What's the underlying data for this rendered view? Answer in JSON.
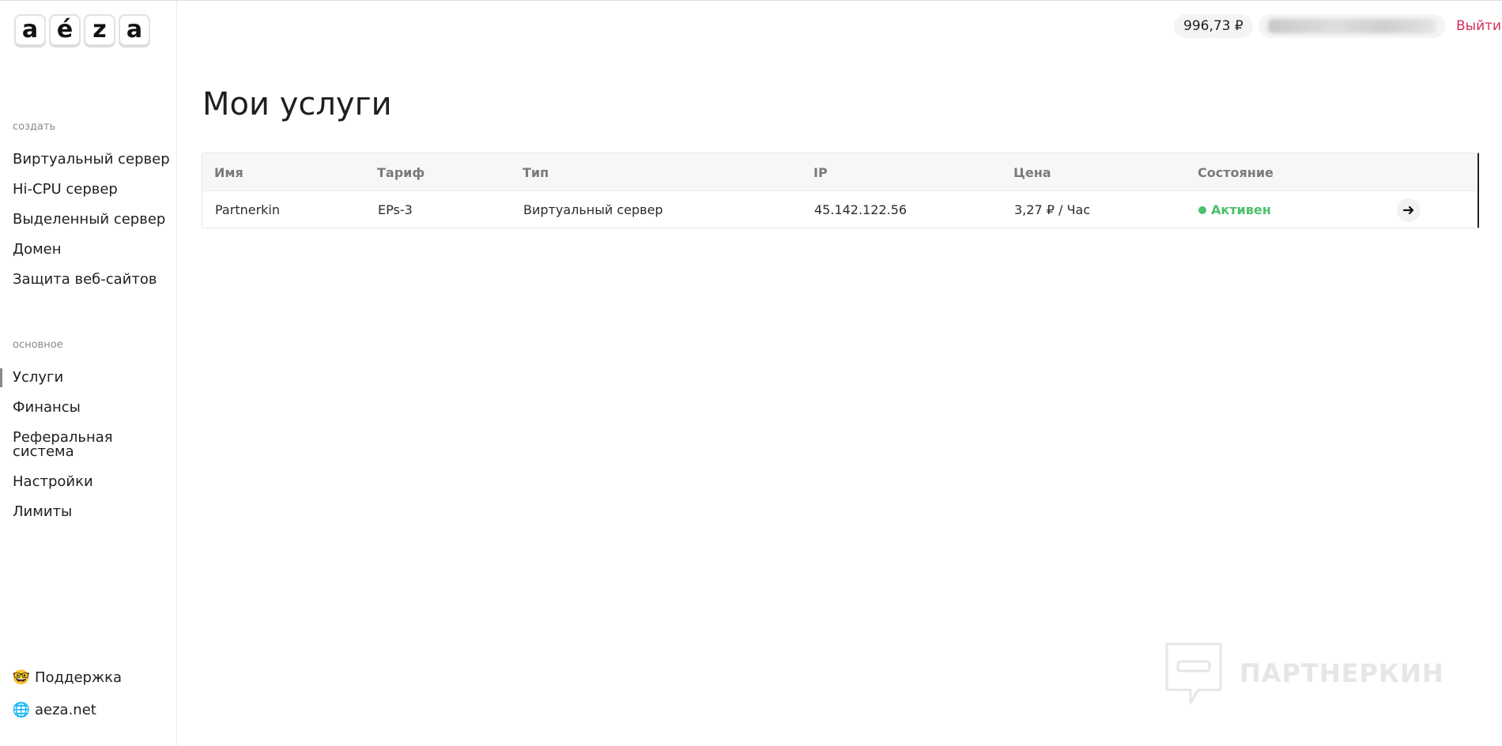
{
  "logo": {
    "letters": [
      "a",
      "é",
      "z",
      "a"
    ]
  },
  "sidebar": {
    "create_label": "создать",
    "create_items": [
      {
        "label": "Виртуальный сервер"
      },
      {
        "label": "Hi-CPU сервер"
      },
      {
        "label": "Выделенный сервер"
      },
      {
        "label": "Домен"
      },
      {
        "label": "Защита веб-сайтов"
      }
    ],
    "main_label": "основное",
    "main_items": [
      {
        "label": "Услуги"
      },
      {
        "label": "Финансы"
      },
      {
        "label": "Реферальная система"
      },
      {
        "label": "Настройки"
      },
      {
        "label": "Лимиты"
      }
    ],
    "bottom": {
      "support": {
        "icon": "nerd-face-icon",
        "emoji": "🤓",
        "label": "Поддержка"
      },
      "site": {
        "icon": "globe-icon",
        "emoji": "🌐",
        "label": "aeza.net"
      }
    }
  },
  "topbar": {
    "balance": "996,73 ₽",
    "logout": "Выйти"
  },
  "main": {
    "title": "Мои услуги",
    "table": {
      "headers": [
        "Имя",
        "Тариф",
        "Тип",
        "IP",
        "Цена",
        "Состояние"
      ],
      "rows": [
        {
          "name": "Partnerkin",
          "tariff": "EPs-3",
          "type": "Виртуальный сервер",
          "ip": "45.142.122.56",
          "price": "3,27 ₽ / Час",
          "status": "Активен"
        }
      ]
    }
  },
  "watermark": {
    "text": "ПАРТНЕРКИН"
  },
  "colors": {
    "accent_logout": "#d0305b",
    "status_active": "#4cc06a"
  }
}
